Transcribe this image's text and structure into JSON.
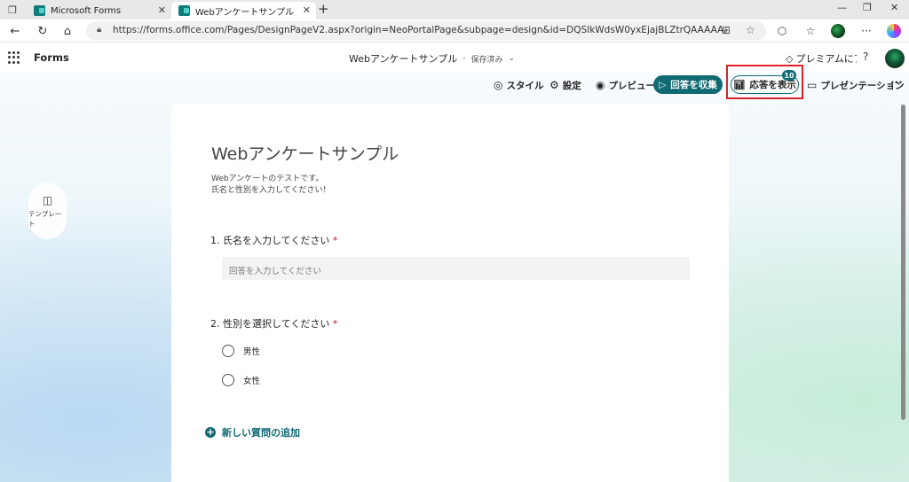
{
  "browser": {
    "tabs": [
      {
        "title": "Microsoft Forms",
        "close": "✕"
      },
      {
        "title": "Webアンケートサンプル",
        "close": "✕"
      }
    ],
    "new_tab": "+",
    "window_controls": {
      "minimize": "—",
      "restore": "❐",
      "close": "✕"
    },
    "url": "https://forms.office.com/Pages/DesignPageV2.aspx?origin=NeoPortalPage&subpage=design&id=DQSIkWdsW0yxEjajBLZtrQAAAAAAAAAAAAAAAAAAAAAAAAAAAAAAAAAAAAAAAAAAAAAAAAAAAAAAAAAAAAAAAAAAAAAAAAAAAAAAAAAAAAAAAAAAAAAAAAAAAAAAAAAAAAAAAAAAAAAAAANAAcQp--xUNEZB...",
    "icons": [
      "tab-actions-icon",
      "back-icon",
      "refresh-icon",
      "home-icon",
      "lock-icon",
      "read-view-icon",
      "favorite-icon",
      "extensions-icon",
      "favorites-bar-icon",
      "collections-icon",
      "more-icon",
      "copilot-icon"
    ]
  },
  "forms_header": {
    "app_name": "Forms",
    "form_title": "Webアンケートサンプル",
    "separator": "-",
    "saved_status": "保存済み",
    "premium": "プレミアムにア",
    "help": "?"
  },
  "commands": {
    "style": "スタイル",
    "settings": "設定",
    "preview": "プレビュー",
    "collect": "回答を収集",
    "view_responses": "応答を表示",
    "responses_count": "10",
    "presentation": "プレゼンテーション",
    "more": "···"
  },
  "sidebar": {
    "template_label": "テンプレート"
  },
  "form": {
    "title": "Webアンケートサンプル",
    "description_line1": "Webアンケートのテストです。",
    "description_line2": "氏名と性別を入力してください！",
    "questions": [
      {
        "number": "1.",
        "text": "氏名を入力してください",
        "required_mark": "*",
        "placeholder": "回答を入力してください"
      },
      {
        "number": "2.",
        "text": "性別を選択してください",
        "required_mark": "*",
        "options": [
          "男性",
          "女性"
        ]
      }
    ],
    "add_question": "新しい質問の追加"
  },
  "colors": {
    "accent": "#0f6a73",
    "highlight": "#e0202a",
    "required": "#c50f1f"
  }
}
